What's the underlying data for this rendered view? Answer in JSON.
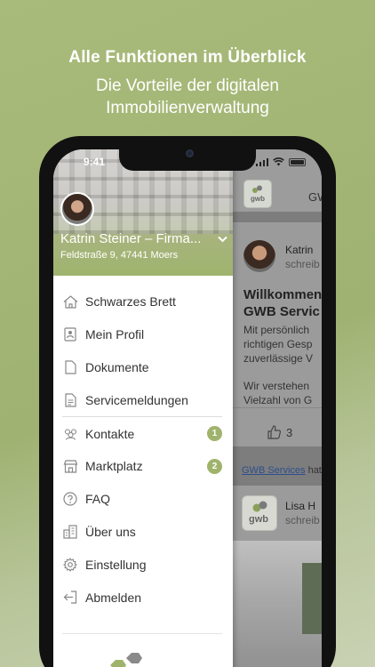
{
  "hero": {
    "title": "Alle Funktionen im Überblick",
    "subtitle_line1": "Die Vorteile der digitalen",
    "subtitle_line2": "Immobilienverwaltung"
  },
  "status_bar": {
    "time": "9:41"
  },
  "drawer": {
    "user_name": "Katrin Steiner – Firma...",
    "address": "Feldstraße 9, 47441 Moers",
    "items": [
      {
        "label": "Schwarzes Brett",
        "icon": "home-icon"
      },
      {
        "label": "Mein Profil",
        "icon": "profile-card-icon"
      },
      {
        "label": "Dokumente",
        "icon": "document-icon"
      },
      {
        "label": "Servicemeldungen",
        "icon": "service-report-icon"
      },
      {
        "label": "Kontakte",
        "icon": "contacts-icon",
        "badge": "1"
      },
      {
        "label": "Marktplatz",
        "icon": "marketplace-icon",
        "badge": "2"
      },
      {
        "label": "FAQ",
        "icon": "question-icon"
      },
      {
        "label": "Über uns",
        "icon": "building-icon"
      },
      {
        "label": "Einstellung",
        "icon": "gear-icon"
      },
      {
        "label": "Abmelden",
        "icon": "logout-icon"
      }
    ]
  },
  "background_feed": {
    "header_text": "GW",
    "logo_text": "gwb",
    "post1": {
      "author": "Katrin",
      "action": "schreib",
      "title_line1": "Willkommen",
      "title_line2": "GWB Servic",
      "body_line1": "Mit persönlich",
      "body_line2": "richtigen Gesp",
      "body_line3": "zuverlässige V",
      "body_line4": "Wir verstehen",
      "body_line5": "Vielzahl von G",
      "likes": "3"
    },
    "shared_link": "GWB Services",
    "shared_suffix": " hat",
    "post2": {
      "author": "Lisa H",
      "action": "schreib"
    }
  },
  "colors": {
    "accent": "#a0b36c",
    "background": "#a9bb7b"
  }
}
